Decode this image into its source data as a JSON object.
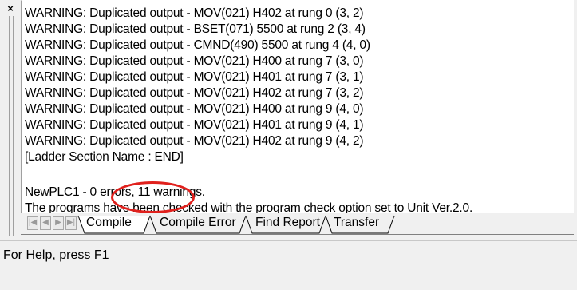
{
  "toolbar": {
    "close_glyph": "×",
    "close_icon": "close-icon"
  },
  "output": {
    "lines": [
      "WARNING: Duplicated output -  MOV(021) H402 at rung 0 (3, 2)",
      "WARNING: Duplicated output -  BSET(071) 5500 at rung 2 (3, 4)",
      "WARNING: Duplicated output -  CMND(490) 5500 at rung 4 (4, 0)",
      "WARNING: Duplicated output -  MOV(021) H400 at rung 7 (3, 0)",
      "WARNING: Duplicated output -  MOV(021) H401 at rung 7 (3, 1)",
      "WARNING: Duplicated output -  MOV(021) H402 at rung 7 (3, 2)",
      "WARNING: Duplicated output -  MOV(021) H400 at rung 9 (4, 0)",
      "WARNING: Duplicated output -  MOV(021) H401 at rung 9 (4, 1)",
      "WARNING: Duplicated output -  MOV(021) H402 at rung 9 (4, 2)",
      "[Ladder Section Name : END]",
      "",
      "NewPLC1 - 0 errors, 11 warnings.",
      "The programs have been checked with the program check option set to Unit Ver.2.0."
    ],
    "highlight_color": "#e0201c"
  },
  "tabs": {
    "nav_first": "|◀",
    "nav_prev": "◀",
    "nav_next": "▶",
    "nav_last": "▶|",
    "items": [
      "Compile",
      "Compile Error",
      "Find Report",
      "Transfer"
    ],
    "active": "Compile"
  },
  "status_bar": {
    "text": "For Help, press F1"
  }
}
